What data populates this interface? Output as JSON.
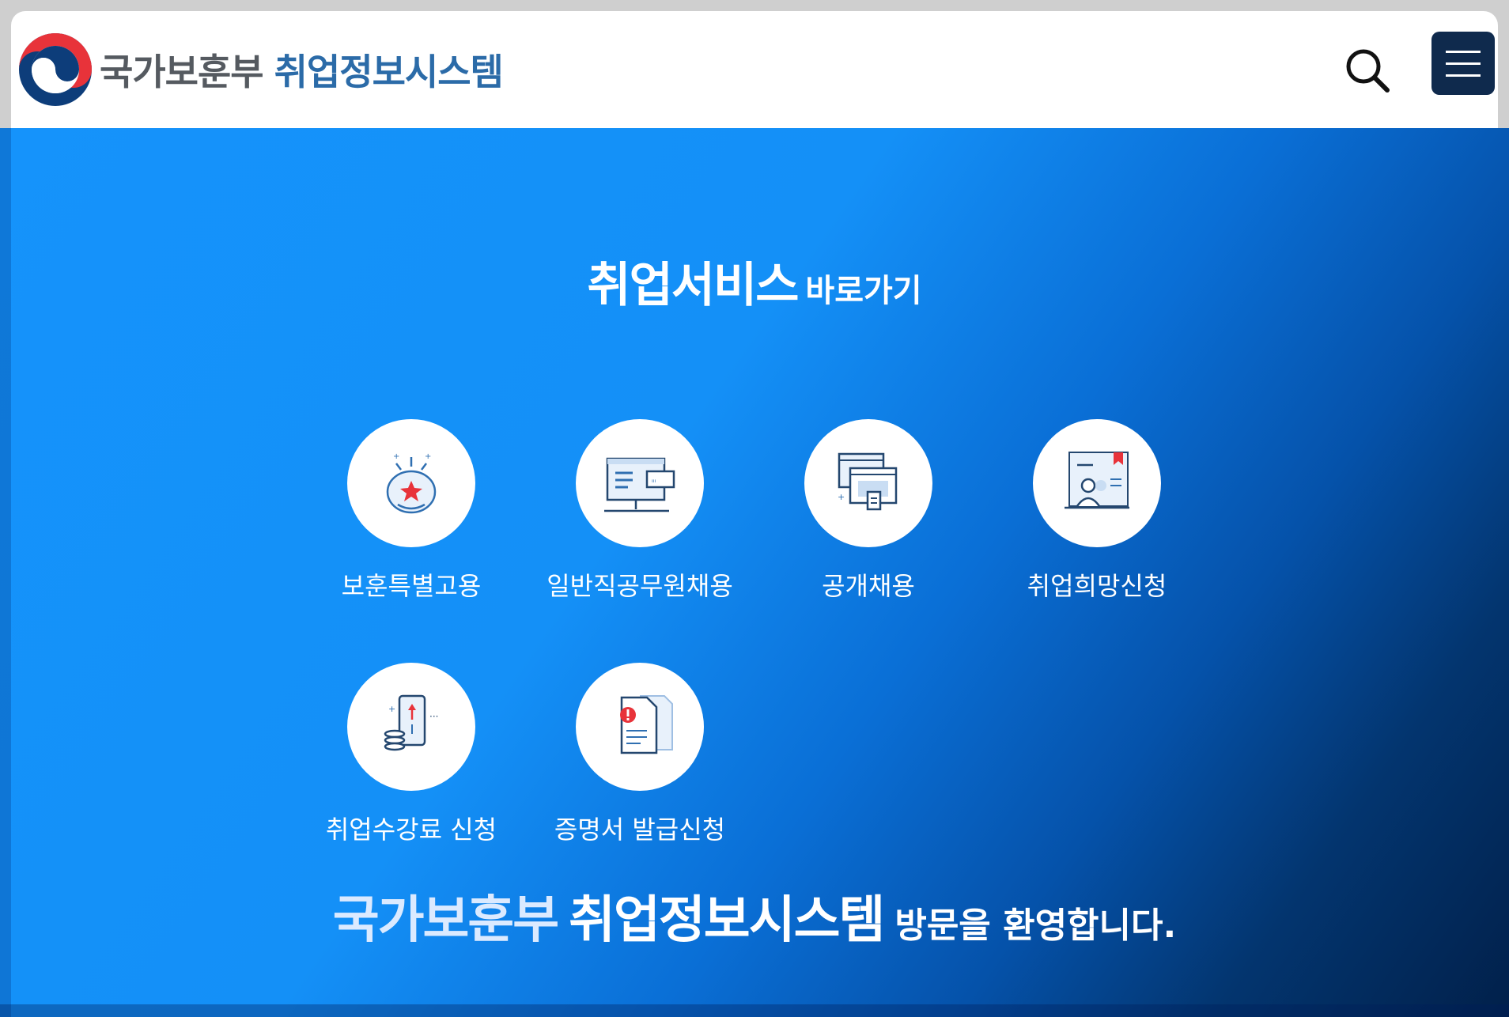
{
  "header": {
    "org_name": "국가보훈부",
    "system_name": "취업정보시스템",
    "search_icon": "search-icon",
    "menu_icon": "hamburger-menu-icon"
  },
  "section": {
    "title": "취업서비스",
    "subtitle": "바로가기"
  },
  "services": [
    {
      "label": "보훈특별고용",
      "icon": "medal-star-icon"
    },
    {
      "label": "일반직공무원채용",
      "icon": "monitor-icon"
    },
    {
      "label": "공개채용",
      "icon": "browser-windows-icon"
    },
    {
      "label": "취업희망신청",
      "icon": "applicants-icon"
    },
    {
      "label": "취업수강료 신청",
      "icon": "phone-coins-icon"
    },
    {
      "label": "증명서 발급신청",
      "icon": "document-alert-icon"
    }
  ],
  "welcome": {
    "org": "국가보훈부",
    "system": "취업정보시스템",
    "message": "방문을 환영합니다."
  },
  "colors": {
    "header_bg": "#ffffff",
    "org_text": "#555a60",
    "system_text": "#2b6ba8",
    "menu_bg": "#0f2a4d",
    "hero_bg_start": "#1593fb",
    "hero_bg_end": "#01204a",
    "icon_red": "#e8333a",
    "icon_blue": "#2f6fb1"
  }
}
